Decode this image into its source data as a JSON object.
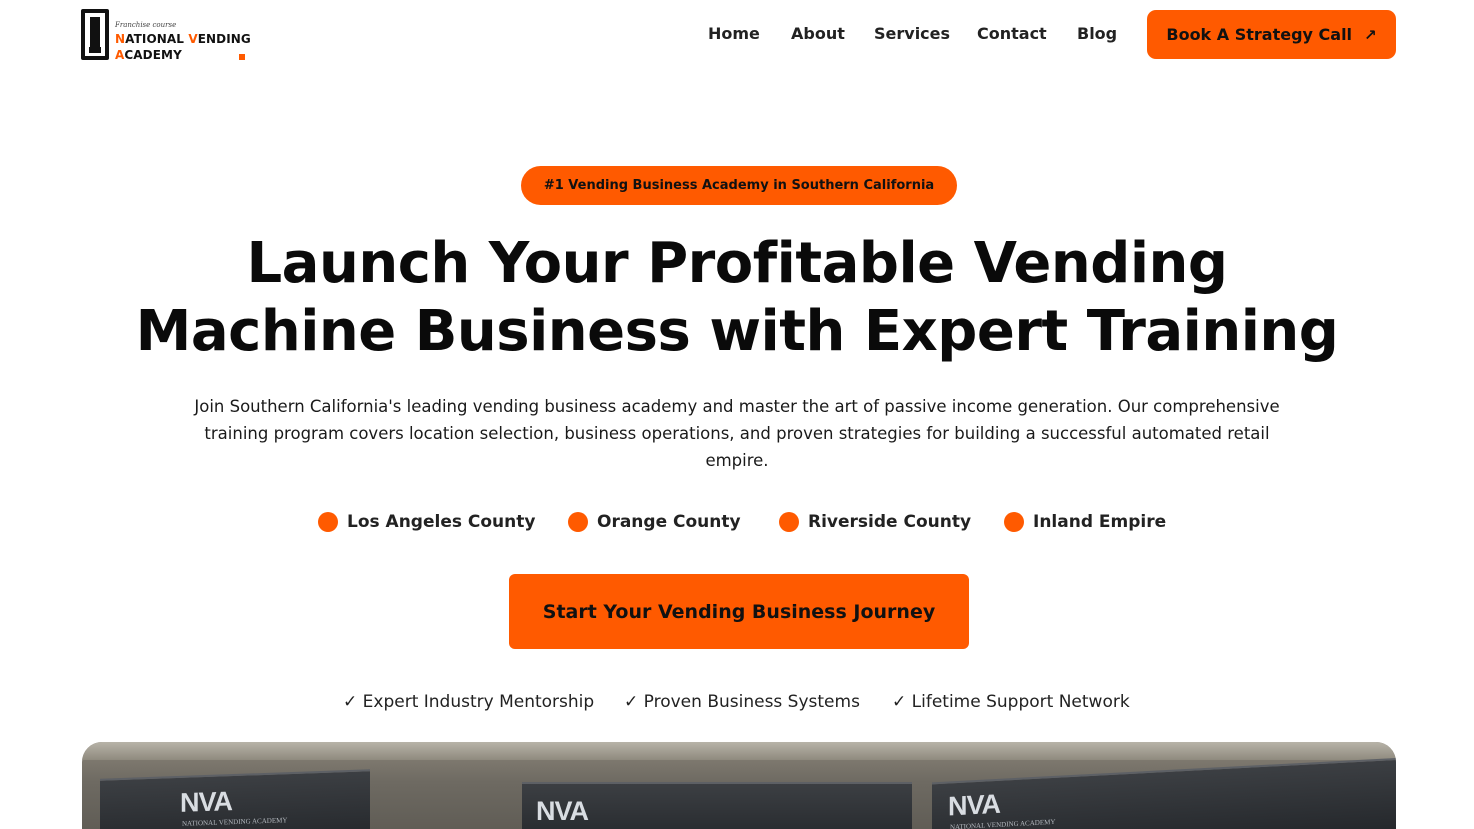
{
  "brand": {
    "tagline": "Franchise course",
    "name_line1_first": "N",
    "name_line1_rest": "ATIONAL ",
    "name_line1_v": "V",
    "name_line1_end": "ENDING",
    "name_line2_first": "A",
    "name_line2_rest": "CADEMY"
  },
  "nav": {
    "items": [
      "Home",
      "About",
      "Services",
      "Contact",
      "Blog"
    ],
    "cta_label": "Book A Strategy Call",
    "cta_arrow": "↗"
  },
  "hero": {
    "badge": "#1 Vending Business Academy in Southern California",
    "headline_line1": "Launch Your Profitable Vending",
    "headline_line2": "Machine Business with Expert Training",
    "subtext": "Join Southern California's leading vending business academy and master the art of passive income generation. Our comprehensive training program covers location selection, business operations, and proven strategies for building a successful automated retail empire.",
    "regions": [
      "Los Angeles County",
      "Orange County",
      "Riverside County",
      "Inland Empire"
    ],
    "cta_label": "Start Your Vending Business Journey",
    "checks": [
      "✓ Expert Industry Mentorship",
      "✓ Proven Business Systems",
      "✓ Lifetime Support Network"
    ]
  },
  "photo": {
    "machine_logo": "NVA",
    "machine_sub": "NATIONAL VENDING ACADEMY"
  },
  "colors": {
    "accent": "#ff5a00",
    "text": "#111111",
    "background": "#ffffff"
  }
}
